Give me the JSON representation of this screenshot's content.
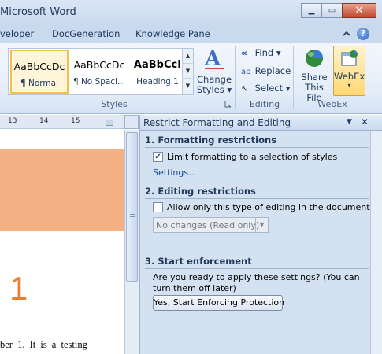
{
  "window": {
    "title": "Microsoft Word",
    "minimize": "▁",
    "maximize": "▭",
    "close": "✕"
  },
  "tabs": [
    "veloper",
    "DocGeneration",
    "Knowledge Pane"
  ],
  "help": "?",
  "ribbon": {
    "styles": {
      "items": [
        {
          "preview": "AaBbCcDc",
          "label": "¶ Normal"
        },
        {
          "preview": "AaBbCcDc",
          "label": "¶ No Spaci..."
        },
        {
          "preview": "AaBbCcI",
          "label": "Heading 1"
        }
      ],
      "change_styles": "Change Styles ▾",
      "group": "Styles"
    },
    "editing": {
      "find": "Find ▾",
      "replace": "Replace",
      "select": "Select ▾",
      "group": "Editing"
    },
    "webex": {
      "share": "Share This File",
      "webex": "WebEx",
      "webex_arrow": "▾",
      "group": "WebEx"
    }
  },
  "ruler": {
    "ticks": [
      "13",
      "14",
      "15"
    ]
  },
  "document": {
    "heading_number": "1",
    "text": "ber 1. It is a testing"
  },
  "pane": {
    "title": "Restrict Formatting and Editing",
    "dropdown": "▼",
    "close": "✕",
    "section1": {
      "title": "1. Formatting restrictions",
      "checkbox_label": "Limit formatting to a selection of styles",
      "checked": true,
      "settings_link": "Settings..."
    },
    "section2": {
      "title": "2. Editing restrictions",
      "checkbox_label": "Allow only this type of editing in the document:",
      "checked": false,
      "combo_value": "No changes (Read only)"
    },
    "section3": {
      "title": "3. Start enforcement",
      "text": "Are you ready to apply these settings? (You can turn them off later)",
      "button": "Yes, Start Enforcing Protection"
    }
  },
  "colors": {
    "doc_band": "#f4b183",
    "heading_number": "#ed7d31",
    "ribbon_bg": "#e4edf8"
  }
}
